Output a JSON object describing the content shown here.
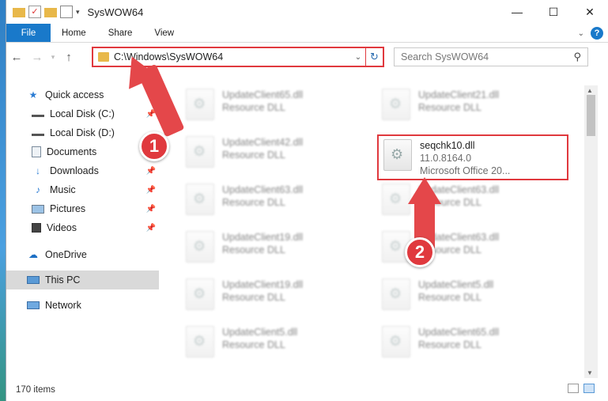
{
  "window": {
    "title": "SysWOW64"
  },
  "ribbon": {
    "tabs": [
      "File",
      "Home",
      "Share",
      "View"
    ]
  },
  "navigation": {
    "address": "C:\\Windows\\SysWOW64",
    "search_placeholder": "Search SysWOW64"
  },
  "sidebar": {
    "items": [
      {
        "label": "Quick access",
        "icon": "star-icon"
      },
      {
        "label": "Local Disk (C:)",
        "icon": "drive-icon"
      },
      {
        "label": "Local Disk (D:)",
        "icon": "drive-icon"
      },
      {
        "label": "Documents",
        "icon": "documents-icon"
      },
      {
        "label": "Downloads",
        "icon": "download-icon"
      },
      {
        "label": "Music",
        "icon": "music-icon"
      },
      {
        "label": "Pictures",
        "icon": "pictures-icon"
      },
      {
        "label": "Videos",
        "icon": "videos-icon"
      },
      {
        "label": "OneDrive",
        "icon": "cloud-icon"
      },
      {
        "label": "This PC",
        "icon": "computer-icon"
      },
      {
        "label": "Network",
        "icon": "network-icon"
      }
    ]
  },
  "files": {
    "left": [
      {
        "name": "UpdateClient65.dll",
        "type": "Resource DLL"
      },
      {
        "name": "UpdateClient42.dll",
        "type": "Resource DLL"
      },
      {
        "name": "UpdateClient63.dll",
        "type": "Resource DLL"
      },
      {
        "name": "UpdateClient19.dll",
        "type": "Resource DLL"
      },
      {
        "name": "UpdateClient19.dll",
        "type": "Resource DLL"
      },
      {
        "name": "UpdateClient5.dll",
        "type": "Resource DLL"
      }
    ],
    "right": [
      {
        "name": "UpdateClient21.dll",
        "type": "Resource DLL"
      },
      {
        "name": "UpdateClient63.dll",
        "type": "Resource DLL"
      },
      {
        "name": "UpdateClient63.dll",
        "type": "Resource DLL"
      },
      {
        "name": "UpdateClient5.dll",
        "type": "Resource DLL"
      },
      {
        "name": "UpdateClient65.dll",
        "type": "Resource DLL"
      }
    ],
    "highlighted": {
      "name": "seqchk10.dll",
      "version": "11.0.8164.0",
      "company": "Microsoft Office 20..."
    }
  },
  "status": {
    "item_count": "170 items"
  },
  "annotations": {
    "step1": "1",
    "step2": "2",
    "color": "#e0393e"
  }
}
